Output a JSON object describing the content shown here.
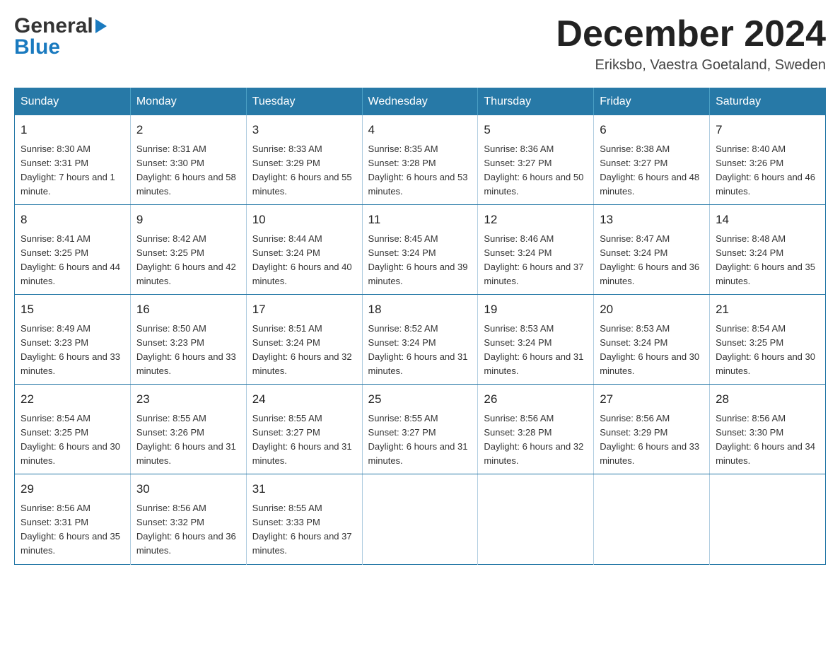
{
  "header": {
    "logo_line1": "General",
    "logo_line2": "Blue",
    "month_title": "December 2024",
    "location": "Eriksbo, Vaestra Goetaland, Sweden"
  },
  "days_of_week": [
    "Sunday",
    "Monday",
    "Tuesday",
    "Wednesday",
    "Thursday",
    "Friday",
    "Saturday"
  ],
  "weeks": [
    [
      {
        "day": "1",
        "sunrise": "8:30 AM",
        "sunset": "3:31 PM",
        "daylight": "7 hours and 1 minute."
      },
      {
        "day": "2",
        "sunrise": "8:31 AM",
        "sunset": "3:30 PM",
        "daylight": "6 hours and 58 minutes."
      },
      {
        "day": "3",
        "sunrise": "8:33 AM",
        "sunset": "3:29 PM",
        "daylight": "6 hours and 55 minutes."
      },
      {
        "day": "4",
        "sunrise": "8:35 AM",
        "sunset": "3:28 PM",
        "daylight": "6 hours and 53 minutes."
      },
      {
        "day": "5",
        "sunrise": "8:36 AM",
        "sunset": "3:27 PM",
        "daylight": "6 hours and 50 minutes."
      },
      {
        "day": "6",
        "sunrise": "8:38 AM",
        "sunset": "3:27 PM",
        "daylight": "6 hours and 48 minutes."
      },
      {
        "day": "7",
        "sunrise": "8:40 AM",
        "sunset": "3:26 PM",
        "daylight": "6 hours and 46 minutes."
      }
    ],
    [
      {
        "day": "8",
        "sunrise": "8:41 AM",
        "sunset": "3:25 PM",
        "daylight": "6 hours and 44 minutes."
      },
      {
        "day": "9",
        "sunrise": "8:42 AM",
        "sunset": "3:25 PM",
        "daylight": "6 hours and 42 minutes."
      },
      {
        "day": "10",
        "sunrise": "8:44 AM",
        "sunset": "3:24 PM",
        "daylight": "6 hours and 40 minutes."
      },
      {
        "day": "11",
        "sunrise": "8:45 AM",
        "sunset": "3:24 PM",
        "daylight": "6 hours and 39 minutes."
      },
      {
        "day": "12",
        "sunrise": "8:46 AM",
        "sunset": "3:24 PM",
        "daylight": "6 hours and 37 minutes."
      },
      {
        "day": "13",
        "sunrise": "8:47 AM",
        "sunset": "3:24 PM",
        "daylight": "6 hours and 36 minutes."
      },
      {
        "day": "14",
        "sunrise": "8:48 AM",
        "sunset": "3:24 PM",
        "daylight": "6 hours and 35 minutes."
      }
    ],
    [
      {
        "day": "15",
        "sunrise": "8:49 AM",
        "sunset": "3:23 PM",
        "daylight": "6 hours and 33 minutes."
      },
      {
        "day": "16",
        "sunrise": "8:50 AM",
        "sunset": "3:23 PM",
        "daylight": "6 hours and 33 minutes."
      },
      {
        "day": "17",
        "sunrise": "8:51 AM",
        "sunset": "3:24 PM",
        "daylight": "6 hours and 32 minutes."
      },
      {
        "day": "18",
        "sunrise": "8:52 AM",
        "sunset": "3:24 PM",
        "daylight": "6 hours and 31 minutes."
      },
      {
        "day": "19",
        "sunrise": "8:53 AM",
        "sunset": "3:24 PM",
        "daylight": "6 hours and 31 minutes."
      },
      {
        "day": "20",
        "sunrise": "8:53 AM",
        "sunset": "3:24 PM",
        "daylight": "6 hours and 30 minutes."
      },
      {
        "day": "21",
        "sunrise": "8:54 AM",
        "sunset": "3:25 PM",
        "daylight": "6 hours and 30 minutes."
      }
    ],
    [
      {
        "day": "22",
        "sunrise": "8:54 AM",
        "sunset": "3:25 PM",
        "daylight": "6 hours and 30 minutes."
      },
      {
        "day": "23",
        "sunrise": "8:55 AM",
        "sunset": "3:26 PM",
        "daylight": "6 hours and 31 minutes."
      },
      {
        "day": "24",
        "sunrise": "8:55 AM",
        "sunset": "3:27 PM",
        "daylight": "6 hours and 31 minutes."
      },
      {
        "day": "25",
        "sunrise": "8:55 AM",
        "sunset": "3:27 PM",
        "daylight": "6 hours and 31 minutes."
      },
      {
        "day": "26",
        "sunrise": "8:56 AM",
        "sunset": "3:28 PM",
        "daylight": "6 hours and 32 minutes."
      },
      {
        "day": "27",
        "sunrise": "8:56 AM",
        "sunset": "3:29 PM",
        "daylight": "6 hours and 33 minutes."
      },
      {
        "day": "28",
        "sunrise": "8:56 AM",
        "sunset": "3:30 PM",
        "daylight": "6 hours and 34 minutes."
      }
    ],
    [
      {
        "day": "29",
        "sunrise": "8:56 AM",
        "sunset": "3:31 PM",
        "daylight": "6 hours and 35 minutes."
      },
      {
        "day": "30",
        "sunrise": "8:56 AM",
        "sunset": "3:32 PM",
        "daylight": "6 hours and 36 minutes."
      },
      {
        "day": "31",
        "sunrise": "8:55 AM",
        "sunset": "3:33 PM",
        "daylight": "6 hours and 37 minutes."
      },
      null,
      null,
      null,
      null
    ]
  ]
}
